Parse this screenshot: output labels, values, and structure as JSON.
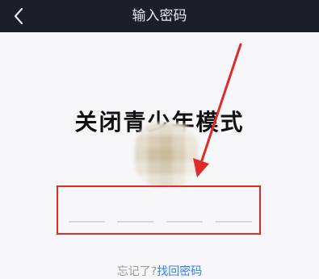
{
  "header": {
    "title": "输入密码",
    "back_icon": "chevron-left-icon"
  },
  "main": {
    "title": "关闭青少年模式",
    "code_length": 4,
    "forgot_text": "忘记了?",
    "forgot_link": "找回密码"
  },
  "annotation": {
    "highlight_color": "#e02a2a"
  }
}
